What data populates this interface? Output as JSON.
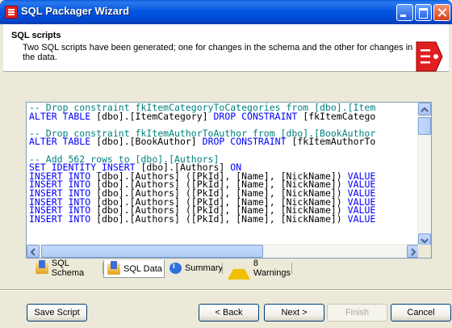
{
  "window": {
    "title": "SQL Packager Wizard",
    "title_color": "#0054e3"
  },
  "header": {
    "title": "SQL scripts",
    "description": "Two SQL scripts have been generated; one for changes in the schema and the other for changes in the data."
  },
  "code_lines": [
    {
      "kind": "comment",
      "text": "-- Drop constraint fkItemCategoryToCategories from [dbo].[Item"
    },
    {
      "kind": "stmt",
      "parts": [
        {
          "k": "kw",
          "t": "ALTER TABLE"
        },
        {
          "k": "tx",
          "t": " [dbo].[ItemCategory] "
        },
        {
          "k": "kw",
          "t": "DROP CONSTRAINT"
        },
        {
          "k": "tx",
          "t": " [fkItemCatego"
        }
      ]
    },
    {
      "kind": "blank"
    },
    {
      "kind": "comment",
      "text": "-- Drop constraint fkItemAuthorToAuthor from [dbo].[BookAuthor"
    },
    {
      "kind": "stmt",
      "parts": [
        {
          "k": "kw",
          "t": "ALTER TABLE"
        },
        {
          "k": "tx",
          "t": " [dbo].[BookAuthor] "
        },
        {
          "k": "kw",
          "t": "DROP CONSTRAINT"
        },
        {
          "k": "tx",
          "t": " [fkItemAuthorTo"
        }
      ]
    },
    {
      "kind": "blank"
    },
    {
      "kind": "comment",
      "text": "-- Add 562 rows to [dbo].[Authors]"
    },
    {
      "kind": "stmt",
      "parts": [
        {
          "k": "kw",
          "t": "SET IDENTITY_INSERT"
        },
        {
          "k": "tx",
          "t": " [dbo].[Authors] "
        },
        {
          "k": "kw",
          "t": "ON"
        }
      ]
    },
    {
      "kind": "stmt",
      "parts": [
        {
          "k": "kw",
          "t": "INSERT INTO"
        },
        {
          "k": "tx",
          "t": " [dbo].[Authors] ([PkId], [Name], [NickName]) "
        },
        {
          "k": "kw",
          "t": "VALUE"
        }
      ]
    },
    {
      "kind": "stmt",
      "parts": [
        {
          "k": "kw",
          "t": "INSERT INTO"
        },
        {
          "k": "tx",
          "t": " [dbo].[Authors] ([PkId], [Name], [NickName]) "
        },
        {
          "k": "kw",
          "t": "VALUE"
        }
      ]
    },
    {
      "kind": "stmt",
      "parts": [
        {
          "k": "kw",
          "t": "INSERT INTO"
        },
        {
          "k": "tx",
          "t": " [dbo].[Authors] ([PkId], [Name], [NickName]) "
        },
        {
          "k": "kw",
          "t": "VALUE"
        }
      ]
    },
    {
      "kind": "stmt",
      "parts": [
        {
          "k": "kw",
          "t": "INSERT INTO"
        },
        {
          "k": "tx",
          "t": " [dbo].[Authors] ([PkId], [Name], [NickName]) "
        },
        {
          "k": "kw",
          "t": "VALUE"
        }
      ]
    },
    {
      "kind": "stmt",
      "parts": [
        {
          "k": "kw",
          "t": "INSERT INTO"
        },
        {
          "k": "tx",
          "t": " [dbo].[Authors] ([PkId], [Name], [NickName]) "
        },
        {
          "k": "kw",
          "t": "VALUE"
        }
      ]
    },
    {
      "kind": "stmt",
      "parts": [
        {
          "k": "kw",
          "t": "INSERT INTO"
        },
        {
          "k": "tx",
          "t": " [dbo].[Authors] ([PkId], [Name], [NickName]) "
        },
        {
          "k": "kw",
          "t": "VALUE"
        }
      ]
    }
  ],
  "tabs": [
    {
      "label": "SQL Schema",
      "icon": "database-icon",
      "active": false
    },
    {
      "label": "SQL Data",
      "icon": "database-icon",
      "active": true
    },
    {
      "label": "Summary",
      "icon": "info-icon",
      "active": false
    },
    {
      "label": "8 Warnings",
      "icon": "warning-icon",
      "active": false
    }
  ],
  "buttons": {
    "save_script": "Save Script",
    "back": "< Back",
    "next": "Next >",
    "finish": "Finish",
    "cancel": "Cancel"
  },
  "colors": {
    "comment": "#008080",
    "keyword": "#0000ff",
    "header_icon": "#e02020"
  }
}
